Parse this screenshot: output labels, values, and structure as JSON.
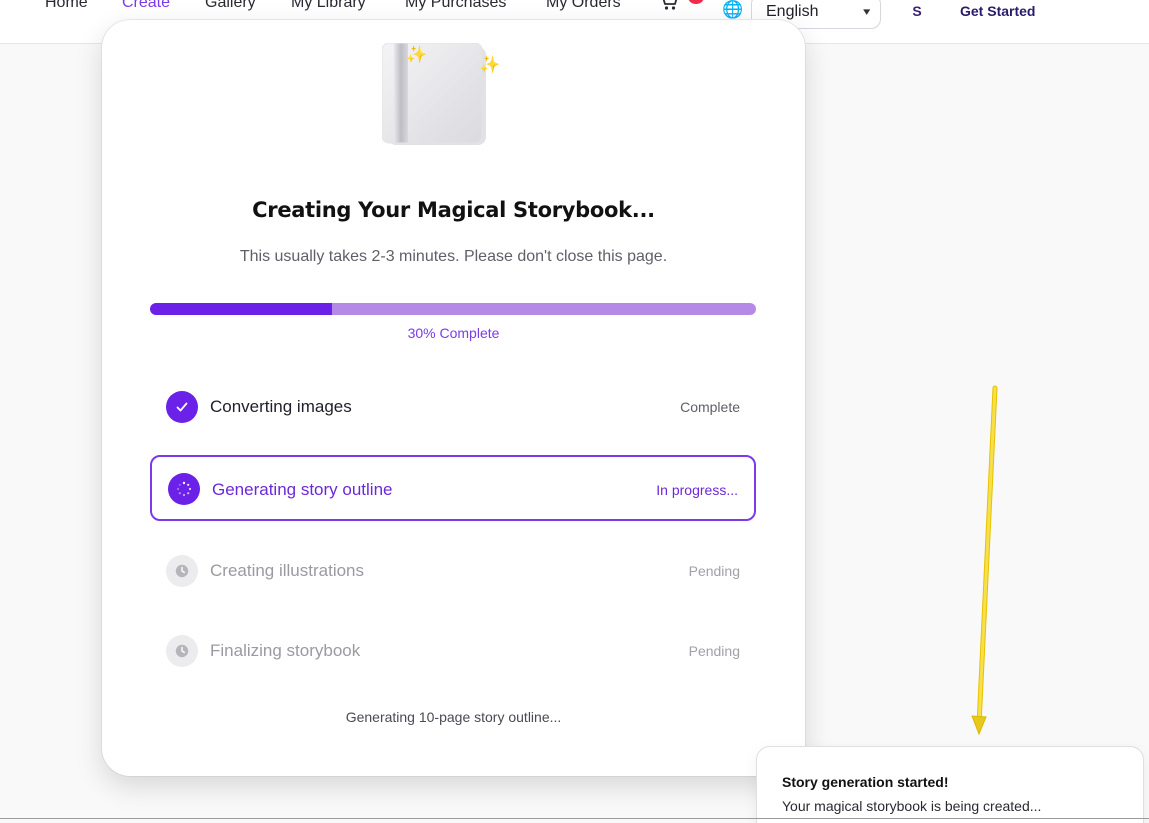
{
  "nav": {
    "links": [
      "Home",
      "Create",
      "Gallery",
      "My Library",
      "My Purchases",
      "My Orders"
    ],
    "active": "Create",
    "language": "English",
    "user_initial": "S",
    "cta": "Get Started",
    "icons": {
      "cart": "cart-icon",
      "globe": "globe-icon"
    }
  },
  "card": {
    "title": "Creating Your Magical Storybook...",
    "subtitle": "This usually takes 2-3 minutes. Please don't close this page.",
    "progress_value": 30,
    "progress_label": "30% Complete",
    "steps": [
      {
        "label": "Converting images",
        "status": "Complete",
        "state": "done"
      },
      {
        "label": "Generating story outline",
        "status": "In progress...",
        "state": "active"
      },
      {
        "label": "Creating illustrations",
        "status": "Pending",
        "state": "pending"
      },
      {
        "label": "Finalizing storybook",
        "status": "Pending",
        "state": "pending"
      }
    ],
    "footer_note": "Generating 10-page story outline..."
  },
  "toast": {
    "title": "Story generation started!",
    "description": "Your magical storybook is being created..."
  },
  "colors": {
    "accent": "#7c3aed",
    "progress_fill": "#6b21e8",
    "progress_track": "#b48ae6",
    "arrow": "#f0d52a"
  }
}
